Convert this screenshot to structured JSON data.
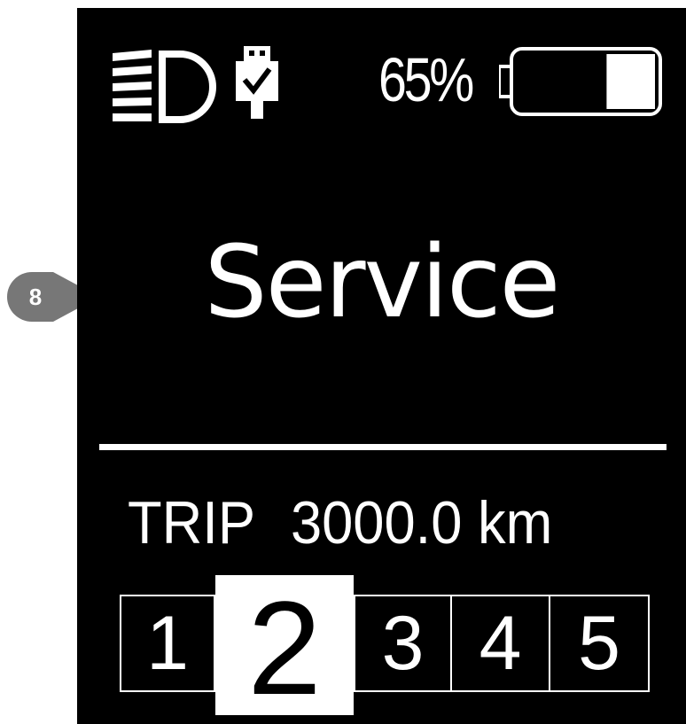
{
  "callout": {
    "number": "8"
  },
  "status": {
    "headlight_icon": "headlight-icon",
    "usb_icon": "usb-connected-icon",
    "battery_percent": "65%",
    "battery_level": 0.35
  },
  "message": "Service",
  "trip": {
    "label": "TRIP",
    "value": "3000.0",
    "unit": "km"
  },
  "assist": {
    "levels": [
      "1",
      "2",
      "3",
      "4",
      "5"
    ],
    "active": "2"
  },
  "colors": {
    "screen_background": "#000000",
    "foreground": "#ffffff",
    "callout": "#777777"
  }
}
